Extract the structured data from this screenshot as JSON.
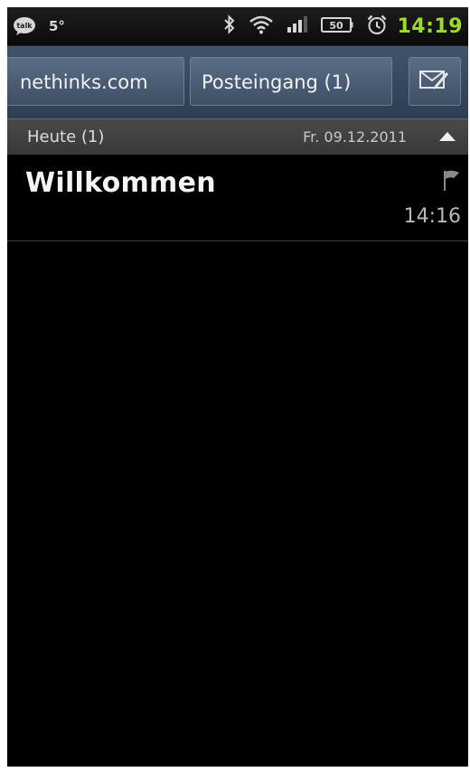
{
  "status_bar": {
    "talk_icon_label": "talk",
    "temperature": "5°",
    "battery_level": "50",
    "clock": "14:19",
    "icons": [
      "talk-icon",
      "bluetooth-icon",
      "wifi-icon",
      "signal-icon",
      "battery-icon",
      "alarm-icon"
    ],
    "clock_color": "#9fdc2a"
  },
  "action_bar": {
    "account": "nethinks.com",
    "folder": "Posteingang (1)",
    "compose_icon": "compose-mail-icon"
  },
  "section": {
    "title": "Heute (1)",
    "date": "Fr. 09.12.2011"
  },
  "messages": [
    {
      "subject": "Willkommen",
      "time": "14:16",
      "flag_icon": "flag-icon"
    }
  ]
}
